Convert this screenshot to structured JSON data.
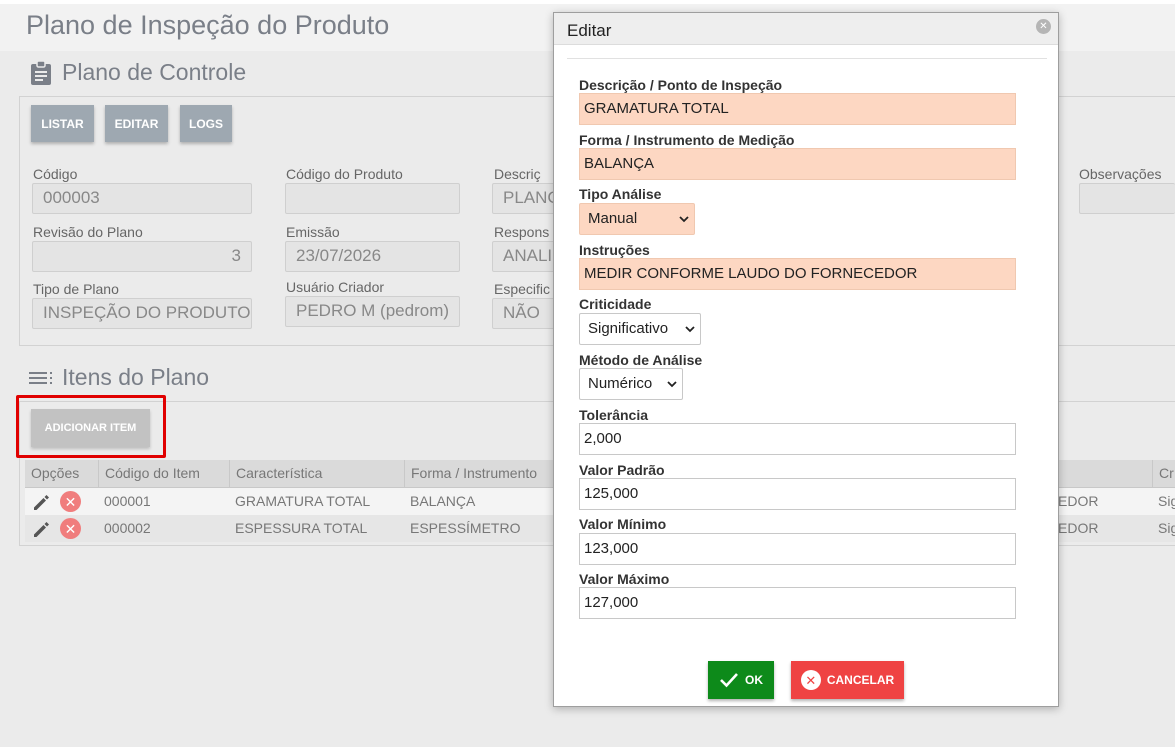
{
  "page": {
    "title": "Plano de Inspeção do Produto"
  },
  "control": {
    "title": "Plano de Controle",
    "buttons": {
      "list": "LISTAR",
      "edit": "EDITAR",
      "logs": "LOGS"
    },
    "fields": {
      "codigo": {
        "label": "Código",
        "value": "000003"
      },
      "codigo_produto": {
        "label": "Código do Produto",
        "value": ""
      },
      "descricao": {
        "label": "Descriç",
        "value": "PLANC"
      },
      "observacoes": {
        "label": "Observações",
        "value": ""
      },
      "revisao": {
        "label": "Revisão do Plano",
        "value": "3"
      },
      "emissao": {
        "label": "Emissão",
        "value": "23/07/2026"
      },
      "responsavel": {
        "label": "Respons",
        "value": "ANALI"
      },
      "tipo_plano": {
        "label": "Tipo de Plano",
        "value": "INSPEÇÃO DO PRODUTO"
      },
      "usuario_criador": {
        "label": "Usuário Criador",
        "value": "PEDRO M (pedrom)"
      },
      "especificacao": {
        "label": "Especific",
        "value": "NÃO"
      }
    }
  },
  "items": {
    "title": "Itens do Plano",
    "add_button": "ADICIONAR ITEM",
    "columns": [
      "Opções",
      "Código do Item",
      "Característica",
      "Forma / Instrumento",
      "Cr"
    ],
    "rows": [
      {
        "code": "000001",
        "char": "GRAMATURA TOTAL",
        "instrument": "BALANÇA",
        "extra": "EDOR",
        "crit": "Sig"
      },
      {
        "code": "000002",
        "char": "ESPESSURA TOTAL",
        "instrument": "ESPESSÍMETRO",
        "extra": "EDOR",
        "crit": "Sig"
      }
    ]
  },
  "dialog": {
    "title": "Editar",
    "descricao": {
      "label": "Descrição / Ponto de Inspeção",
      "value": "GRAMATURA TOTAL"
    },
    "forma": {
      "label": "Forma / Instrumento de Medição",
      "value": "BALANÇA"
    },
    "tipo": {
      "label": "Tipo Análise",
      "value": "Manual"
    },
    "instrucoes": {
      "label": "Instruções",
      "value": "MEDIR CONFORME LAUDO DO FORNECEDOR"
    },
    "criticidade": {
      "label": "Criticidade",
      "value": "Significativo"
    },
    "metodo": {
      "label": "Método de Análise",
      "value": "Numérico"
    },
    "tolerancia": {
      "label": "Tolerância",
      "value": "2,000"
    },
    "padrao": {
      "label": "Valor Padrão",
      "value": "125,000"
    },
    "minimo": {
      "label": "Valor Mínimo",
      "value": "123,000"
    },
    "maximo": {
      "label": "Valor Máximo",
      "value": "127,000"
    },
    "ok": "OK",
    "cancel": "CANCELAR"
  },
  "colors": {
    "highlight_required": "#fdd7c2",
    "ok_green": "#0d8a1a",
    "cancel_red": "#ef4343",
    "annotation_red": "#e00000"
  }
}
